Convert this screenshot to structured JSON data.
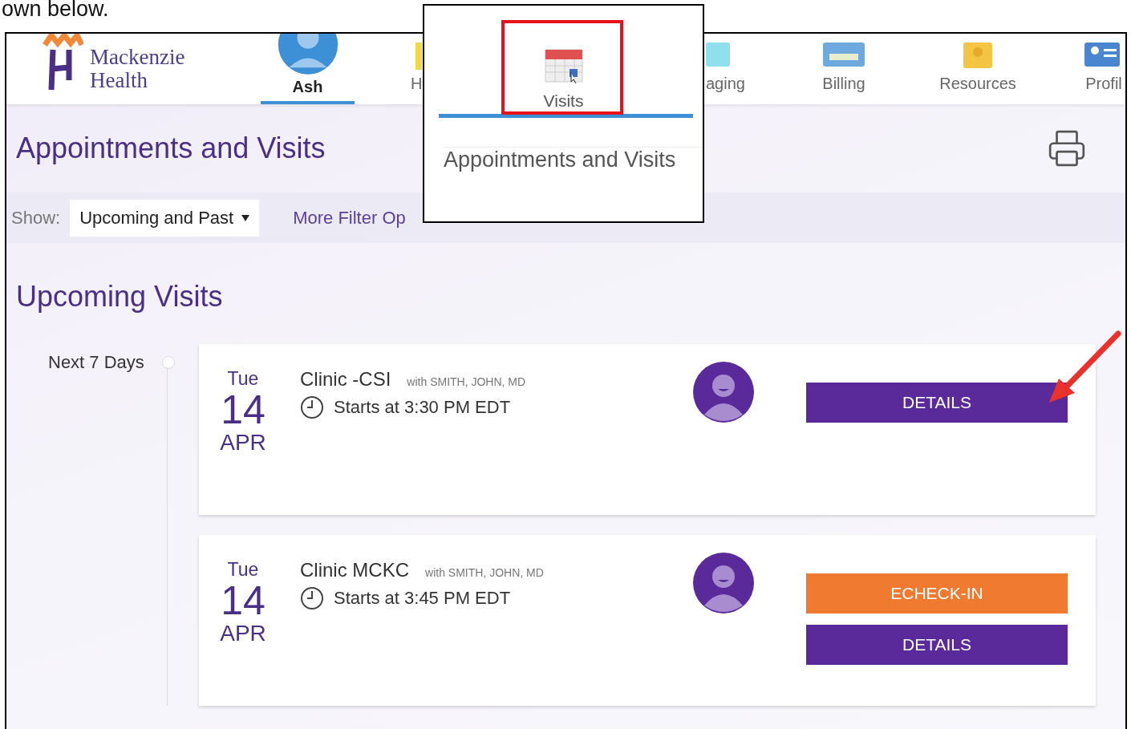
{
  "document_text": "own below.",
  "portal": {
    "logo": {
      "line1": "Mackenzie",
      "line2": "Health"
    },
    "nav": [
      {
        "label": "Ash",
        "selected": true
      },
      {
        "label": "H",
        "selected": false
      },
      {
        "label": "aging",
        "selected": false
      },
      {
        "label": "Billing",
        "selected": false
      },
      {
        "label": "Resources",
        "selected": false
      },
      {
        "label": "Profil",
        "selected": false
      }
    ],
    "page_title": "Appointments and Visits",
    "filter": {
      "label": "Show:",
      "value": "Upcoming and Past",
      "more_link": "More Filter Op"
    },
    "section_title": "Upcoming Visits",
    "timeline_label": "Next 7 Days",
    "visits": [
      {
        "weekday": "Tue",
        "day": "14",
        "month": "APR",
        "clinic": "Clinic -CSI",
        "provider": "with SMITH, JOHN, MD",
        "time": "Starts at 3:30 PM EDT",
        "buttons": [
          {
            "label": "DETAILS",
            "kind": "details"
          }
        ]
      },
      {
        "weekday": "Tue",
        "day": "14",
        "month": "APR",
        "clinic": "Clinic MCKC",
        "provider": "with SMITH, JOHN, MD",
        "time": "Starts at 3:45 PM EDT",
        "buttons": [
          {
            "label": "ECHECK-IN",
            "kind": "echeck"
          },
          {
            "label": "DETAILS",
            "kind": "details"
          }
        ]
      }
    ]
  },
  "callout": {
    "tab_label": "Visits",
    "highlighted": true,
    "heading": "Appointments and Visits"
  }
}
